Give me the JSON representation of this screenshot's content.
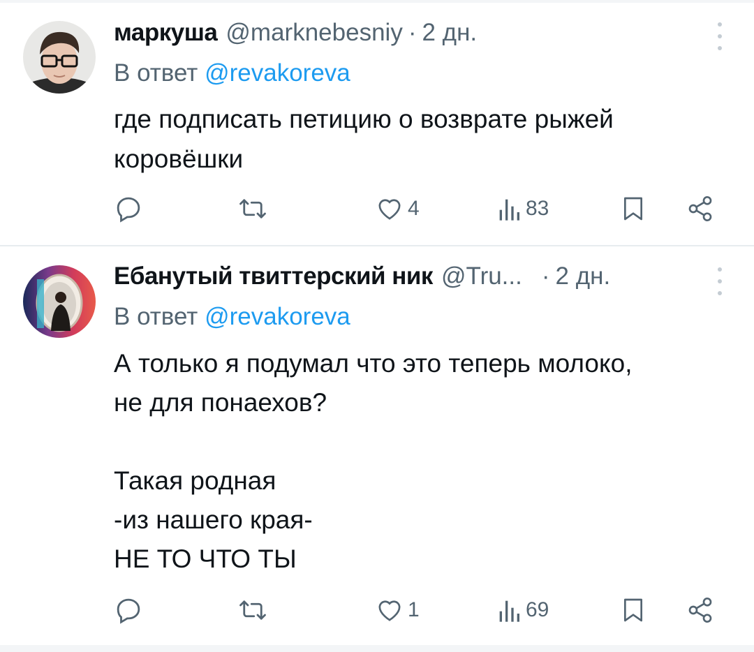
{
  "tweets": [
    {
      "display_name": "маркуша",
      "handle": "@marknebesniy",
      "separator": "·",
      "time": "2 дн.",
      "reply_prefix": "В ответ",
      "reply_mention": "@revakoreva",
      "text": "где подписать петицию о возврате рыжей\nкоровёшки",
      "likes": "4",
      "views": "83"
    },
    {
      "display_name": "Ебанутый твиттерский ник",
      "handle": "@Tru...",
      "separator": "·",
      "time": "2 дн.",
      "reply_prefix": "В ответ",
      "reply_mention": "@revakoreva",
      "text": "А только я подумал что это теперь молоко,\nне для понаехов?\n\nТакая родная\n-из нашего края-\nНЕ ТО ЧТО ТЫ",
      "likes": "1",
      "views": "69"
    }
  ],
  "colors": {
    "text": "#0f1419",
    "secondary": "#536471",
    "link": "#1d9bf0",
    "divider": "#e7ecef"
  },
  "icons": [
    "reply-icon",
    "retweet-icon",
    "like-icon",
    "views-icon",
    "bookmark-icon",
    "share-icon",
    "more-icon"
  ]
}
